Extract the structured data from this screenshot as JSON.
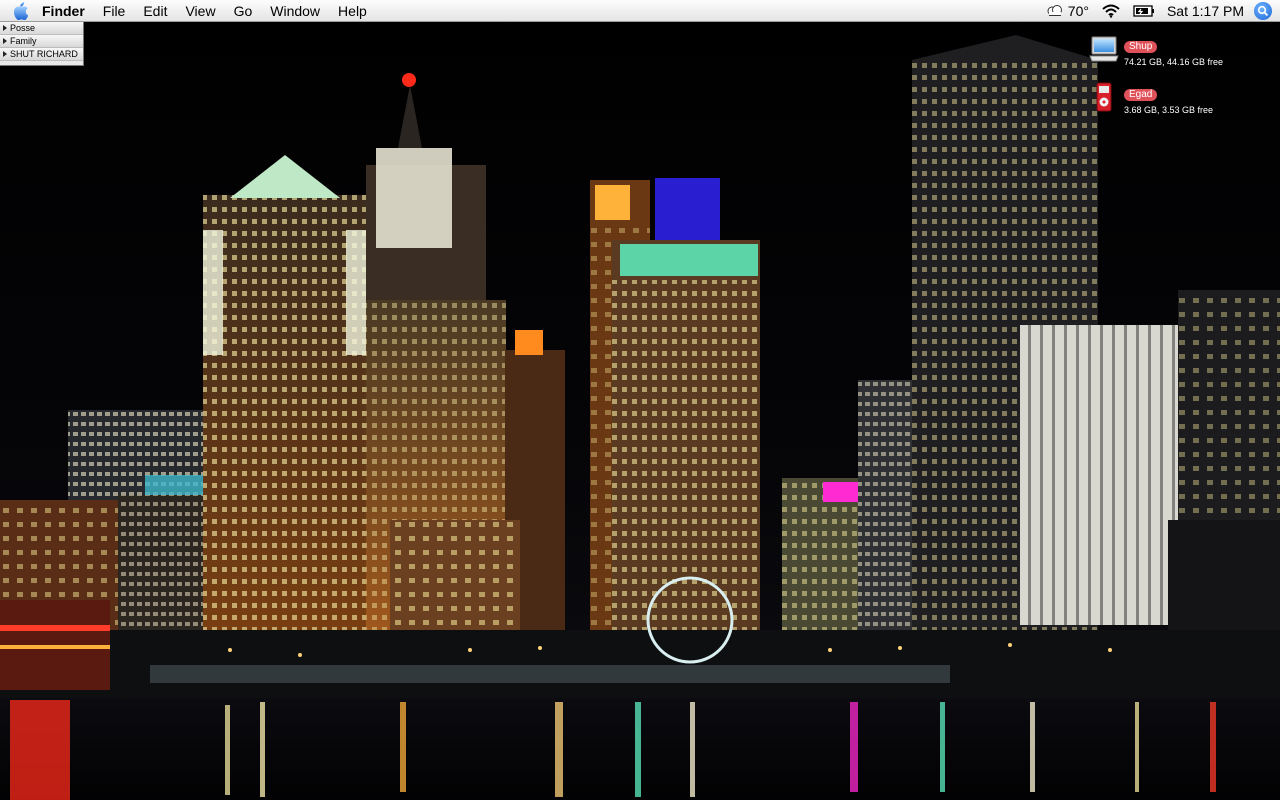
{
  "menubar": {
    "app_name": "Finder",
    "menus": [
      "File",
      "Edit",
      "View",
      "Go",
      "Window",
      "Help"
    ],
    "status": {
      "temperature": "70°",
      "clock": "Sat 1:17 PM"
    }
  },
  "drawer": {
    "items": [
      "Posse",
      "Family",
      "SHUT RICHARD"
    ]
  },
  "disks": [
    {
      "name": "Shup",
      "info": "74.21 GB, 44.16 GB free",
      "icon": "hard-drive-icon"
    },
    {
      "name": "Egad",
      "info": "3.68 GB, 3.53 GB free",
      "icon": "ipod-icon"
    }
  ],
  "colors": {
    "label_red": "#e0525a",
    "spotlight_blue": "#1a63d6"
  }
}
